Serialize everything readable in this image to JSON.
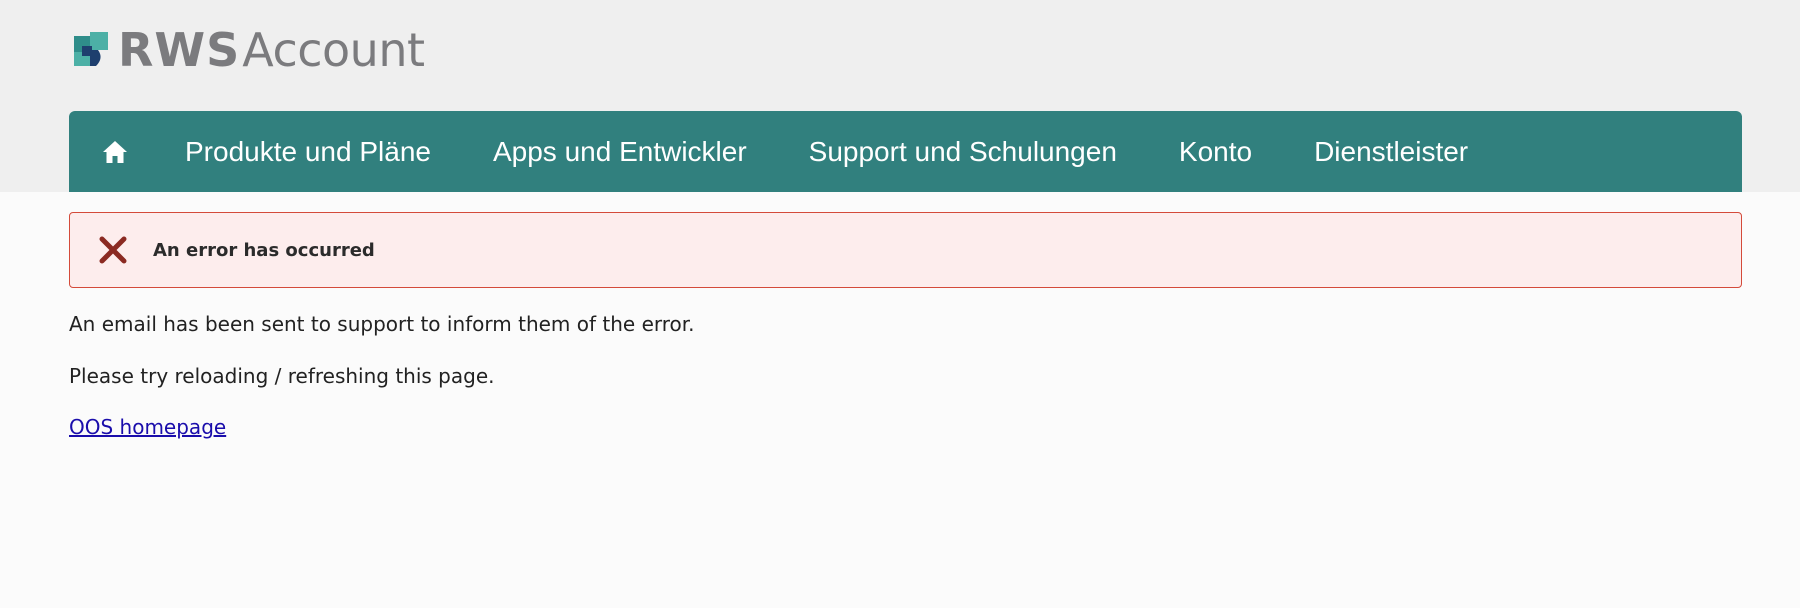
{
  "header": {
    "logo": {
      "brand": "RWS",
      "product": "Account"
    },
    "nav": {
      "home_icon": "home-icon",
      "items": [
        {
          "label": "Produkte und Pläne"
        },
        {
          "label": "Apps und Entwickler"
        },
        {
          "label": "Support und Schulungen"
        },
        {
          "label": "Konto"
        },
        {
          "label": "Dienstleister"
        }
      ]
    }
  },
  "alert": {
    "icon": "close-x-icon",
    "title": "An error has occurred"
  },
  "content": {
    "message_1": "An email has been sent to support to inform them of the error.",
    "message_2": "Please try reloading / refreshing this page.",
    "link_label": "OOS homepage"
  },
  "colors": {
    "nav_bg": "#31807e",
    "alert_bg": "#fdeded",
    "alert_border": "#d44a3a",
    "error_icon": "#8b2a22",
    "link": "#1a0dab"
  }
}
